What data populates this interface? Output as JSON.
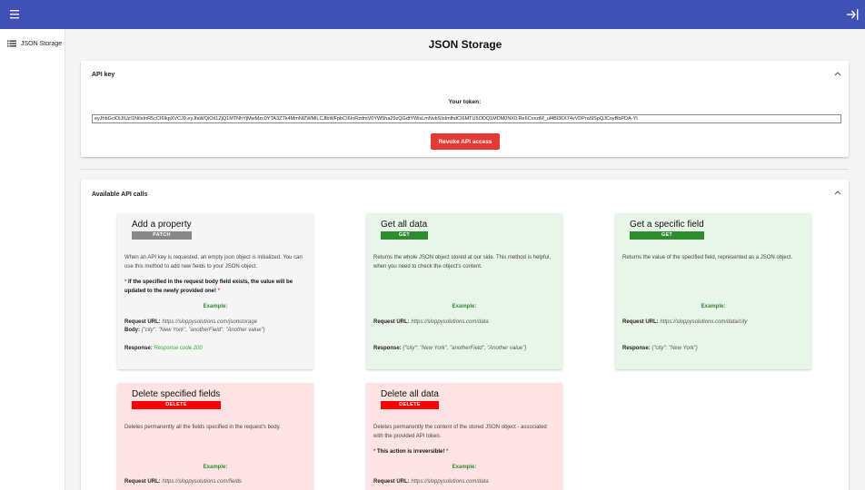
{
  "app": {
    "title": "JSON Storage"
  },
  "sidebar": {
    "items": [
      {
        "label": "JSON Storage",
        "icon": "list-icon"
      }
    ]
  },
  "api_key_panel": {
    "title": "API key",
    "token_label": "Your token:",
    "token_value": "eyJhbGciOiJIUzI1NiIsInR5cCI6IkpXVCJ9.eyJfaWQiOiI1ZjQ1MTNhYjMwMzc0YTA3ZTk4MmNlZWMiLCJlbWFpbCI6InRzdmV0YW5ha29zQGdtYWlsLmNvbSIsImlhdCI6MTU5ODQ1MDM0NX0.Re6CvxziM_ul4Bl36X74vVDPra5lSpQJCoyBbPDA-YI",
    "revoke_label": "Revoke API access"
  },
  "calls_panel": {
    "title": "Available API calls",
    "example_label": "Example:",
    "request_url_label": "Request URL:",
    "body_label": "Body:",
    "response_label": "Response:",
    "cards": [
      {
        "title": "Add a property",
        "method": "PATCH",
        "description": "When an API key is requested, an empty json object is initialized. You can use this method to add new fields to your JSON object.",
        "warning": "If the specified in the request body field exists, the value will be updated to the newly provided one!",
        "request_url": "https://sloppysolutions.com/jsonstorage",
        "body": "{\"city\": \"New York\", \"anotherField\": \"Another value\"}",
        "response": "Response code 200"
      },
      {
        "title": "Get all data",
        "method": "GET",
        "description": "Returns the whole JSON object stored at our side. This method is helpful, when you need to check the object's content.",
        "request_url": "https://sloppysolutions.com/data",
        "response": "{\"city\": \"New York\", \"anotherField\", \"Another value\"}"
      },
      {
        "title": "Get a specific field",
        "method": "GET",
        "description": "Returns the value of the specified field, represented as a JSON object.",
        "request_url": "https://sloppysolutions.com/data/city",
        "response": "{\"city\": \"New York\"}"
      },
      {
        "title": "Delete specified fields",
        "method": "DELETE",
        "description": "Deletes permanently all the fields specified in the request's body.",
        "request_url": "https://sloppysolutions.com/fields"
      },
      {
        "title": "Delete all data",
        "method": "DELETE",
        "description": "Deletes permanently the content of the stored JSON object - associated with the provided API token.",
        "warning": "This action is irreversible!",
        "request_url": "https://sloppysolutions.com/data"
      }
    ]
  },
  "colors": {
    "topbar": "#3f51b5",
    "revoke": "#e53935",
    "get": "#2e8b2e",
    "patch": "#888888",
    "delete": "#ff0000"
  }
}
